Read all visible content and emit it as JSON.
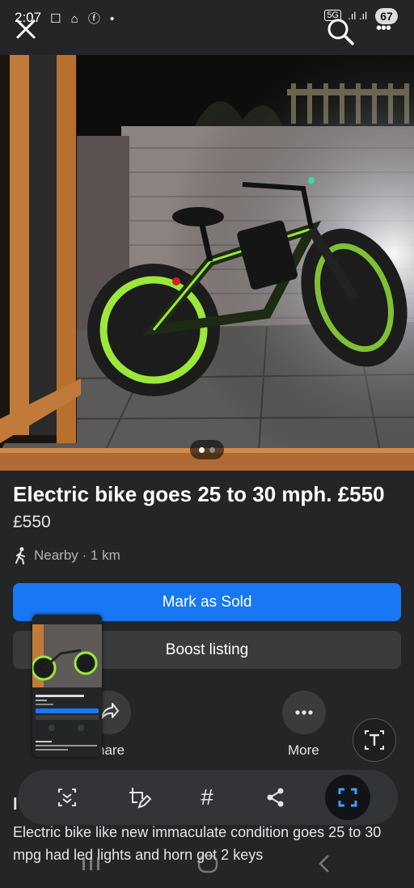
{
  "status_bar": {
    "time": "2:07",
    "notification_icons": "☐ ⌂ ⓕ •",
    "network": "5G",
    "signal": ".ıl .ıl",
    "battery": "67"
  },
  "header": {
    "close_icon": "close-icon",
    "search_icon": "search-icon",
    "more_icon": "ellipsis-icon",
    "overflow_glyph": "•••"
  },
  "photo": {
    "description_colors": {
      "tire_rim": "#9be83a",
      "wall": "#8a7f7a",
      "frame": "#c77a3a"
    },
    "pager_count": 2,
    "pager_active": 0
  },
  "listing": {
    "title": "Electric bike goes 25 to 30 mph.  £550",
    "price": "£550",
    "location": "Nearby · 1 km"
  },
  "buttons": {
    "mark_sold": "Mark as Sold",
    "boost": "Boost listing",
    "share": "hare",
    "more": "More"
  },
  "description": {
    "section_letter": "l",
    "text": "Electric bike like new immaculate condition goes 25 to 30 mpg had led lights and horn  got 2 keys"
  },
  "thumbnail": {
    "title": "Electric bike goes 25 to 30 mph. £550",
    "price": "£550",
    "location": "Nearby · 1 km",
    "mark_sold": "Mark as Sold",
    "boost": "Boost listing",
    "share": "Share",
    "more": "More",
    "section": "Description",
    "desc": "Electric bike like new immaculate condition goes 25 to 30 mpg had led lights and horn got 2 keys"
  },
  "toolbar": {
    "icons": [
      "scan-icon",
      "edit-crop-icon",
      "hashtag-icon",
      "share-icon",
      "capture-icon"
    ],
    "hashtag": "#"
  },
  "colors": {
    "background": "#242526",
    "primary": "#1877f2",
    "secondary": "#3a3b3c",
    "capture_accent": "#3da0ff"
  }
}
